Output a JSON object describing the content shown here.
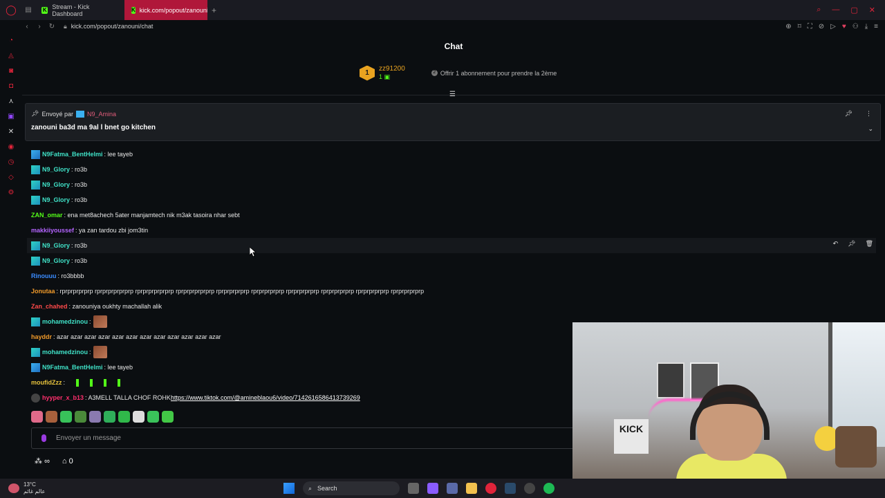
{
  "browser": {
    "tabs": [
      {
        "label": "Stream - Kick Dashboard",
        "active": false
      },
      {
        "label": "kick.com/popout/zanouni",
        "active": true
      }
    ],
    "url": "kick.com/popout/zanouni/chat"
  },
  "chat": {
    "title": "Chat",
    "gift": {
      "badge": "1",
      "user": "zz91200",
      "count": "1",
      "offer": "Offrir 1 abonnement pour prendre la 2ème"
    },
    "pinned": {
      "sent_by_label": "Envoyé par",
      "author": "N9_Amina",
      "message": "zanouni ba3d ma 9al l bnet go kitchen"
    },
    "messages": [
      {
        "user": "N9Fatma_BentHelmi",
        "text": ": lee tayeb",
        "color": "#3fe0c6",
        "badge": "blue"
      },
      {
        "user": "N9_Glory",
        "text": ": ro3b",
        "color": "#3fe0c6",
        "badge": "teal"
      },
      {
        "user": "N9_Glory",
        "text": ": ro3b",
        "color": "#3fe0c6",
        "badge": "teal"
      },
      {
        "user": "N9_Glory",
        "text": ": ro3b",
        "color": "#3fe0c6",
        "badge": "teal"
      },
      {
        "user": "ZAN_omar",
        "text": ": ena met8achech 5ater manjamtech nik m3ak tasoira nhar sebt",
        "color": "#53fc18",
        "badge": ""
      },
      {
        "user": "makkiiyoussef",
        "text": ": ya zan tardou zbi jom3tin",
        "color": "#b464ff",
        "badge": ""
      },
      {
        "user": "N9_Glory",
        "text": ": ro3b",
        "color": "#3fe0c6",
        "badge": "teal"
      },
      {
        "user": "N9_Glory",
        "text": ": ro3b",
        "color": "#3fe0c6",
        "badge": "teal"
      },
      {
        "user": "Rinouuu",
        "text": ": ro3bbbb",
        "color": "#3a8cff",
        "badge": ""
      },
      {
        "user": "Jonutaa",
        "text": ": rprprprprprp rprprprprprprp rprprprprprprp rprprprprprprp rprprprprprp rprprprprprp rprprprprprp rprprprprprp rprprprprprp rprprprprprp",
        "color": "#f09a2a",
        "badge": ""
      },
      {
        "user": "Zan_chahed",
        "text": ": zanouniya oukhty machallah alik",
        "color": "#ff4a4a",
        "badge": ""
      },
      {
        "user": "mohamedzinou",
        "text": ":",
        "color": "#3fe0c6",
        "badge": "teal",
        "emote": true
      },
      {
        "user": "hayddr",
        "text": ": azar azar azar azar azar azar azar azar azar azar azar azar",
        "color": "#f09a2a",
        "badge": ""
      },
      {
        "user": "mohamedzinou",
        "text": ":",
        "color": "#3fe0c6",
        "badge": "teal",
        "emote": true
      },
      {
        "user": "N9Fatma_BentHelmi",
        "text": ": lee tayeb",
        "color": "#3fe0c6",
        "badge": "blue"
      },
      {
        "user": "moufidZzz",
        "text": ":",
        "color": "#e6c23c",
        "badge": "",
        "bars": true
      },
      {
        "user": "hyyper_x_b13",
        "text": ": A3MELL TALLA CHOF ROHK ",
        "color": "#ff2f6d",
        "badge": "ico",
        "link": "https://www.tiktok.com/@amineblaou6/video/7142616586413739269"
      }
    ],
    "input_placeholder": "Envoyer un message",
    "bottom": {
      "points": "∞",
      "count": "0"
    }
  },
  "taskbar": {
    "weather_temp": "13°C",
    "weather_desc": "عالم غائم",
    "search_label": "Search"
  },
  "colors": {
    "accent": "#53fc18",
    "opera": "#e0243a"
  }
}
